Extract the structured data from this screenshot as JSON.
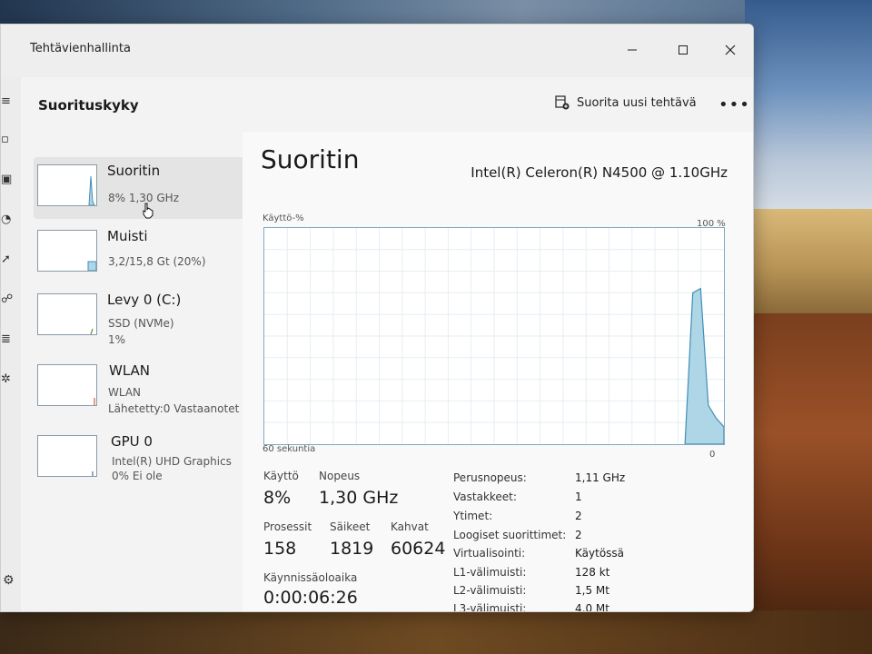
{
  "window": {
    "title": "Tehtävienhallinta"
  },
  "header": {
    "title": "Suorituskyky",
    "run_task_label": "Suorita uusi tehtävä",
    "more_label": "•••"
  },
  "sidebar": {
    "items": [
      {
        "name": "Suoritin",
        "sub1": "8% 1,30 GHz",
        "sub2": ""
      },
      {
        "name": "Muisti",
        "sub1": "3,2/15,8 Gt (20%)",
        "sub2": ""
      },
      {
        "name": "Levy 0 (C:)",
        "sub1": "SSD (NVMe)",
        "sub2": "1%"
      },
      {
        "name": "WLAN",
        "sub1": "WLAN",
        "sub2": "Lähetetty:0 Vastaanotet"
      },
      {
        "name": "GPU 0",
        "sub1": "Intel(R) UHD Graphics",
        "sub2": "0% Ei ole"
      }
    ]
  },
  "main": {
    "heading": "Suoritin",
    "model": "Intel(R) Celeron(R) N4500 @ 1.10GHz",
    "graph": {
      "label": "Käyttö-%",
      "max": "100 %",
      "time": "60 sekuntia",
      "min": "0",
      "usage_series": [
        0,
        0,
        0,
        0,
        0,
        0,
        0,
        0,
        0,
        0,
        0,
        0,
        0,
        0,
        0,
        0,
        0,
        0,
        0,
        0,
        0,
        0,
        0,
        0,
        0,
        0,
        0,
        0,
        0,
        0,
        0,
        0,
        0,
        0,
        0,
        0,
        0,
        0,
        0,
        0,
        0,
        0,
        0,
        0,
        0,
        0,
        0,
        0,
        0,
        0,
        0,
        0,
        0,
        0,
        0,
        70,
        72,
        18,
        12,
        8
      ]
    },
    "stats": {
      "usage_label": "Käyttö",
      "usage_value": "8%",
      "speed_label": "Nopeus",
      "speed_value": "1,30 GHz",
      "processes_label": "Prosessit",
      "processes_value": "158",
      "threads_label": "Säikeet",
      "threads_value": "1819",
      "handles_label": "Kahvat",
      "handles_value": "60624",
      "uptime_label": "Käynnissäoloaika",
      "uptime_value": "0:00:06:26"
    },
    "specs": [
      {
        "label": "Perusnopeus:",
        "value": "1,11 GHz"
      },
      {
        "label": "Vastakkeet:",
        "value": "1"
      },
      {
        "label": "Ytimet:",
        "value": "2"
      },
      {
        "label": "Loogiset suorittimet:",
        "value": "2"
      },
      {
        "label": "Virtualisointi:",
        "value": "Käytössä"
      },
      {
        "label": "L1-välimuisti:",
        "value": "128 kt"
      },
      {
        "label": "L2-välimuisti:",
        "value": "1,5 Mt"
      },
      {
        "label": "L3-välimuisti:",
        "value": "4,0 Mt"
      }
    ]
  },
  "colors": {
    "graph_fill": "#aed6e6",
    "graph_line": "#3f8fb7",
    "grid": "#e6eef3"
  }
}
